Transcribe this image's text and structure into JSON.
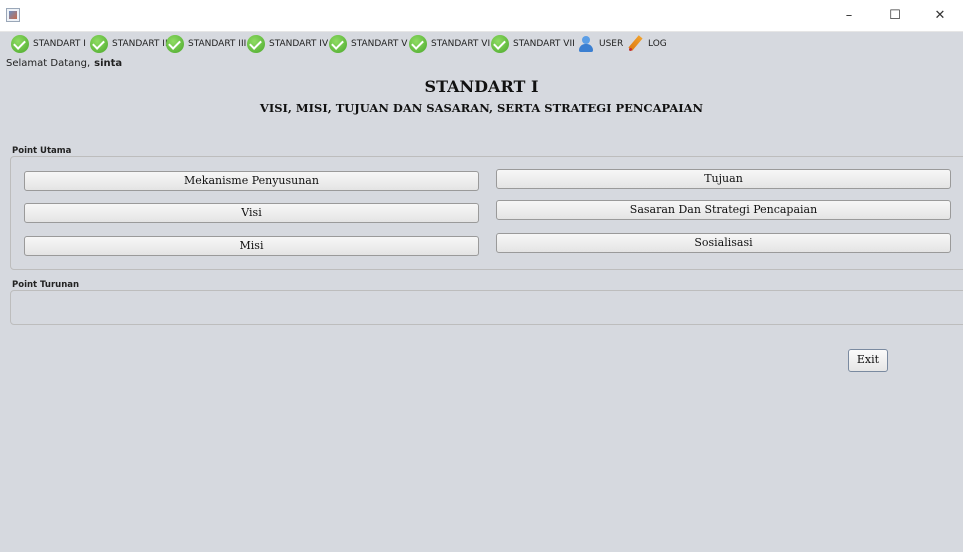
{
  "window": {
    "minimize": "–",
    "maximize": "☐",
    "close": "✕"
  },
  "menu": [
    {
      "label": "STANDART I",
      "icon": "check-circle-icon"
    },
    {
      "label": "STANDART II",
      "icon": "check-circle-icon"
    },
    {
      "label": "STANDART III",
      "icon": "check-circle-icon"
    },
    {
      "label": "STANDART IV",
      "icon": "check-circle-icon"
    },
    {
      "label": "STANDART V",
      "icon": "check-circle-icon"
    },
    {
      "label": "STANDART VI",
      "icon": "check-circle-icon"
    },
    {
      "label": "STANDART VII",
      "icon": "check-circle-icon"
    },
    {
      "label": "USER",
      "icon": "user-icon"
    },
    {
      "label": "LOG",
      "icon": "pencil-icon"
    }
  ],
  "welcome": {
    "label": "Selamat Datang,",
    "username": "sinta"
  },
  "heading": {
    "title": "STANDART I",
    "subtitle": "VISI, MISI, TUJUAN DAN SASARAN, SERTA STRATEGI PENCAPAIAN"
  },
  "point_utama": {
    "label": "Point Utama",
    "buttons": [
      "Mekanisme Penyusunan",
      "Tujuan",
      "Visi",
      "Sasaran Dan Strategi Pencapaian",
      "Misi",
      "Sosialisasi"
    ]
  },
  "point_turunan": {
    "label": "Point Turunan"
  },
  "exit_label": "Exit"
}
